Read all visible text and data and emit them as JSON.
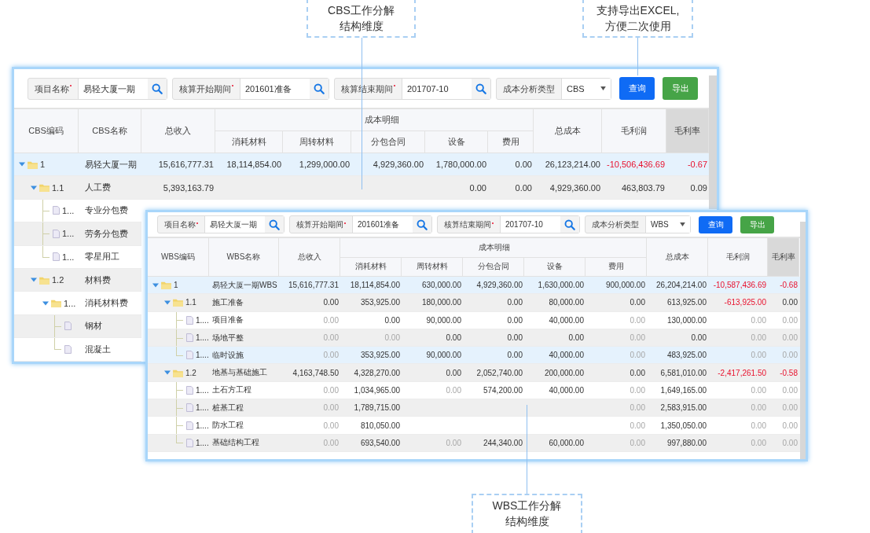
{
  "callouts": [
    {
      "text": "CBS工作分解结构维度"
    },
    {
      "text": "支持导出EXCEL,\n方便二次使用"
    },
    {
      "text": "WBS工作分解结构维度"
    }
  ],
  "panels": [
    {
      "filters": [
        {
          "label": "项目名称",
          "required": true,
          "value": "易轻大厦一期"
        },
        {
          "label": "核算开始期间",
          "required": true,
          "value": "201601准备"
        },
        {
          "label": "核算结束期间",
          "required": true,
          "value": "201707-10"
        }
      ],
      "type_select": {
        "label": "成本分析类型",
        "value": "CBS"
      },
      "buttons": [
        {
          "label": "查询",
          "kind": "primary"
        },
        {
          "label": "导出",
          "kind": "success"
        }
      ],
      "key_columns": [
        {
          "label": "CBS编码"
        },
        {
          "label": "CBS名称"
        }
      ],
      "group_header": {
        "label": "成本明细"
      },
      "columns": [
        {
          "label": "总收入",
          "grouped": false
        },
        {
          "label": "消耗材料",
          "grouped": true
        },
        {
          "label": "周转材料",
          "grouped": true
        },
        {
          "label": "分包合同",
          "grouped": true
        },
        {
          "label": "设备",
          "grouped": true
        },
        {
          "label": "费用",
          "grouped": true
        },
        {
          "label": "总成本",
          "grouped": false
        },
        {
          "label": "毛利润",
          "grouped": false
        },
        {
          "label": "毛利率",
          "grouped": false,
          "highlighted": true
        }
      ],
      "rows": [
        {
          "code": "1",
          "name": "易轻大厦一期",
          "kind": "folder",
          "expanded": true,
          "selected": true,
          "cells": [
            "15,616,777.31",
            "18,114,854.00",
            "1,299,000.00",
            "4,929,360.00",
            "1,780,000.00",
            "0.00",
            "26,123,214.00",
            {
              "text": "-10,506,436.69",
              "negative": true
            },
            {
              "text": "-0.67",
              "negative": true
            }
          ],
          "children": [
            {
              "code": "1.1",
              "name": "人工费",
              "kind": "folder",
              "expanded": true,
              "selected": false,
              "cells": [
                "5,393,163.79",
                null,
                null,
                null,
                "0.00",
                "0.00",
                "4,929,360.00",
                "463,803.79",
                "0.09"
              ],
              "children": [
                {
                  "code": "1...",
                  "name": "专业分包费",
                  "kind": "file",
                  "selected": false
                },
                {
                  "code": "1...",
                  "name": "劳务分包费",
                  "kind": "file",
                  "selected": false
                },
                {
                  "code": "1...",
                  "name": "零星用工",
                  "kind": "file",
                  "selected": false
                }
              ]
            },
            {
              "code": "1.2",
              "name": "材料费",
              "kind": "folder",
              "expanded": true,
              "selected": false,
              "children": [
                {
                  "code": "1...",
                  "name": "消耗材料费",
                  "kind": "folder",
                  "expanded": true,
                  "selected": false,
                  "children": [
                    {
                      "name": "钢材",
                      "kind": "file",
                      "selected": false
                    },
                    {
                      "name": "混凝土",
                      "kind": "file",
                      "selected": false
                    }
                  ]
                }
              ]
            }
          ]
        }
      ]
    },
    {
      "filters": [
        {
          "label": "项目名称",
          "required": true,
          "value": "易轻大厦一期"
        },
        {
          "label": "核算开始期间",
          "required": true,
          "value": "201601准备"
        },
        {
          "label": "核算结束期间",
          "required": true,
          "value": "201707-10"
        }
      ],
      "type_select": {
        "label": "成本分析类型",
        "value": "WBS"
      },
      "buttons": [
        {
          "label": "查询",
          "kind": "primary"
        },
        {
          "label": "导出",
          "kind": "success"
        }
      ],
      "key_columns": [
        {
          "label": "WBS编码"
        },
        {
          "label": "WBS名称"
        }
      ],
      "group_header": {
        "label": "成本明细"
      },
      "columns": [
        {
          "label": "总收入",
          "grouped": false
        },
        {
          "label": "消耗材料",
          "grouped": true
        },
        {
          "label": "周转材料",
          "grouped": true
        },
        {
          "label": "分包合同",
          "grouped": true
        },
        {
          "label": "设备",
          "grouped": true
        },
        {
          "label": "费用",
          "grouped": true
        },
        {
          "label": "总成本",
          "grouped": false
        },
        {
          "label": "毛利润",
          "grouped": false
        },
        {
          "label": "毛利率",
          "grouped": false,
          "highlighted": true
        }
      ],
      "rows": [
        {
          "code": "1",
          "name": "易轻大厦一期WBS",
          "kind": "folder",
          "expanded": true,
          "selected": true,
          "cells": [
            "15,616,777.31",
            "18,114,854.00",
            "630,000.00",
            "4,929,360.00",
            "1,630,000.00",
            "900,000.00",
            "26,204,214.00",
            {
              "text": "-10,587,436.69",
              "negative": true
            },
            {
              "text": "-0.68",
              "negative": true
            }
          ],
          "children": [
            {
              "code": "1.1",
              "name": "施工准备",
              "kind": "folder",
              "expanded": true,
              "selected": false,
              "cells": [
                "0.00",
                "353,925.00",
                "180,000.00",
                "0.00",
                "80,000.00",
                "0.00",
                "613,925.00",
                {
                  "text": "-613,925.00",
                  "negative": true
                },
                "0.00"
              ],
              "children": [
                {
                  "code": "1....",
                  "name": "项目准备",
                  "kind": "file",
                  "selected": false,
                  "cells": [
                    {
                      "text": "0.00",
                      "muted": true
                    },
                    "0.00",
                    "90,000.00",
                    "0.00",
                    "40,000.00",
                    {
                      "text": "0.00",
                      "muted": true
                    },
                    "130,000.00",
                    {
                      "text": "0.00",
                      "muted": true
                    },
                    {
                      "text": "0.00",
                      "muted": true
                    }
                  ]
                },
                {
                  "code": "1....",
                  "name": "场地平整",
                  "kind": "file",
                  "selected": false,
                  "cells": [
                    {
                      "text": "0.00",
                      "muted": true
                    },
                    {
                      "text": "0.00",
                      "muted": true
                    },
                    "0.00",
                    "0.00",
                    "0.00",
                    {
                      "text": "0.00",
                      "muted": true
                    },
                    "0.00",
                    {
                      "text": "0.00",
                      "muted": true
                    },
                    {
                      "text": "0.00",
                      "muted": true
                    }
                  ]
                },
                {
                  "code": "1....",
                  "name": "临时设施",
                  "kind": "file",
                  "selected": true,
                  "cells": [
                    {
                      "text": "0.00",
                      "muted": true
                    },
                    "353,925.00",
                    "90,000.00",
                    "0.00",
                    "40,000.00",
                    {
                      "text": "0.00",
                      "muted": true
                    },
                    "483,925.00",
                    {
                      "text": "0.00",
                      "muted": true
                    },
                    {
                      "text": "0.00",
                      "muted": true
                    }
                  ]
                }
              ]
            },
            {
              "code": "1.2",
              "name": "地基与基础施工",
              "kind": "folder",
              "expanded": true,
              "selected": false,
              "cells": [
                "4,163,748.50",
                "4,328,270.00",
                "0.00",
                "2,052,740.00",
                "200,000.00",
                "0.00",
                "6,581,010.00",
                {
                  "text": "-2,417,261.50",
                  "negative": true
                },
                {
                  "text": "-0.58",
                  "negative": true
                }
              ],
              "children": [
                {
                  "code": "1....",
                  "name": "土石方工程",
                  "kind": "file",
                  "selected": false,
                  "cells": [
                    {
                      "text": "0.00",
                      "muted": true
                    },
                    "1,034,965.00",
                    {
                      "text": "0.00",
                      "muted": true
                    },
                    "574,200.00",
                    "40,000.00",
                    {
                      "text": "0.00",
                      "muted": true
                    },
                    "1,649,165.00",
                    {
                      "text": "0.00",
                      "muted": true
                    },
                    {
                      "text": "0.00",
                      "muted": true
                    }
                  ]
                },
                {
                  "code": "1....",
                  "name": "桩基工程",
                  "kind": "file",
                  "selected": false,
                  "cells": [
                    {
                      "text": "0.00",
                      "muted": true
                    },
                    "1,789,715.00",
                    null,
                    null,
                    null,
                    {
                      "text": "0.00",
                      "muted": true
                    },
                    "2,583,915.00",
                    {
                      "text": "0.00",
                      "muted": true
                    },
                    {
                      "text": "0.00",
                      "muted": true
                    }
                  ]
                },
                {
                  "code": "1....",
                  "name": "防水工程",
                  "kind": "file",
                  "selected": false,
                  "cells": [
                    {
                      "text": "0.00",
                      "muted": true
                    },
                    "810,050.00",
                    null,
                    null,
                    null,
                    {
                      "text": "0.00",
                      "muted": true
                    },
                    "1,350,050.00",
                    {
                      "text": "0.00",
                      "muted": true
                    },
                    {
                      "text": "0.00",
                      "muted": true
                    }
                  ]
                },
                {
                  "code": "1....",
                  "name": "基础结构工程",
                  "kind": "file",
                  "selected": false,
                  "cells": [
                    {
                      "text": "0.00",
                      "muted": true
                    },
                    "693,540.00",
                    {
                      "text": "0.00",
                      "muted": true
                    },
                    "244,340.00",
                    "60,000.00",
                    {
                      "text": "0.00",
                      "muted": true
                    },
                    "997,880.00",
                    {
                      "text": "0.00",
                      "muted": true
                    },
                    {
                      "text": "0.00",
                      "muted": true
                    }
                  ]
                }
              ]
            }
          ]
        }
      ]
    }
  ]
}
